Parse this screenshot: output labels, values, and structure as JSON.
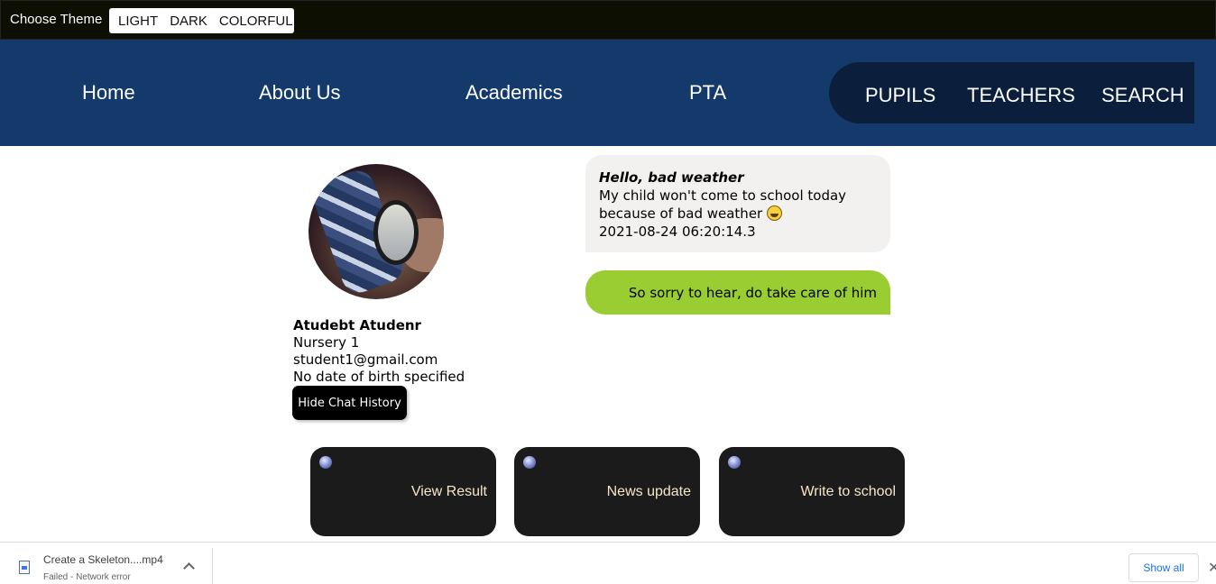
{
  "theme_bar": {
    "label": "Choose Theme",
    "options": [
      "LIGHT",
      "DARK",
      "COLORFUL"
    ]
  },
  "nav": {
    "links": [
      "Home",
      "About Us",
      "Academics",
      "PTA"
    ],
    "pill_links": [
      "PUPILS",
      "TEACHERS",
      "SEARCH"
    ]
  },
  "profile": {
    "name": "Atudebt Atudenr",
    "class": "Nursery 1",
    "email": "student1@gmail.com",
    "dob": "No date of birth specified",
    "hide_chat_button": "Hide Chat History"
  },
  "chat": {
    "incoming": {
      "subject": "Hello, bad weather",
      "line1": "My child won't come to school today",
      "line2": "because of bad weather",
      "timestamp": "2021-08-24 06:20:14.3"
    },
    "outgoing": {
      "text": "So sorry to hear, do take care of him"
    }
  },
  "cards": [
    "View Result",
    "News update",
    "Write to school"
  ],
  "download_bar": {
    "file_name": "Create a Skeleton....mp4",
    "status": "Failed - Network error",
    "show_all": "Show all",
    "close": "✕"
  },
  "colors": {
    "nav_bg": "#143a6b",
    "nav_pill_bg": "#0b1f3d",
    "theme_bar_bg": "#0d0f02",
    "outgoing_bubble": "#9acd32",
    "incoming_bubble": "#f2f1ef",
    "card_bg": "#1b1b1b"
  }
}
